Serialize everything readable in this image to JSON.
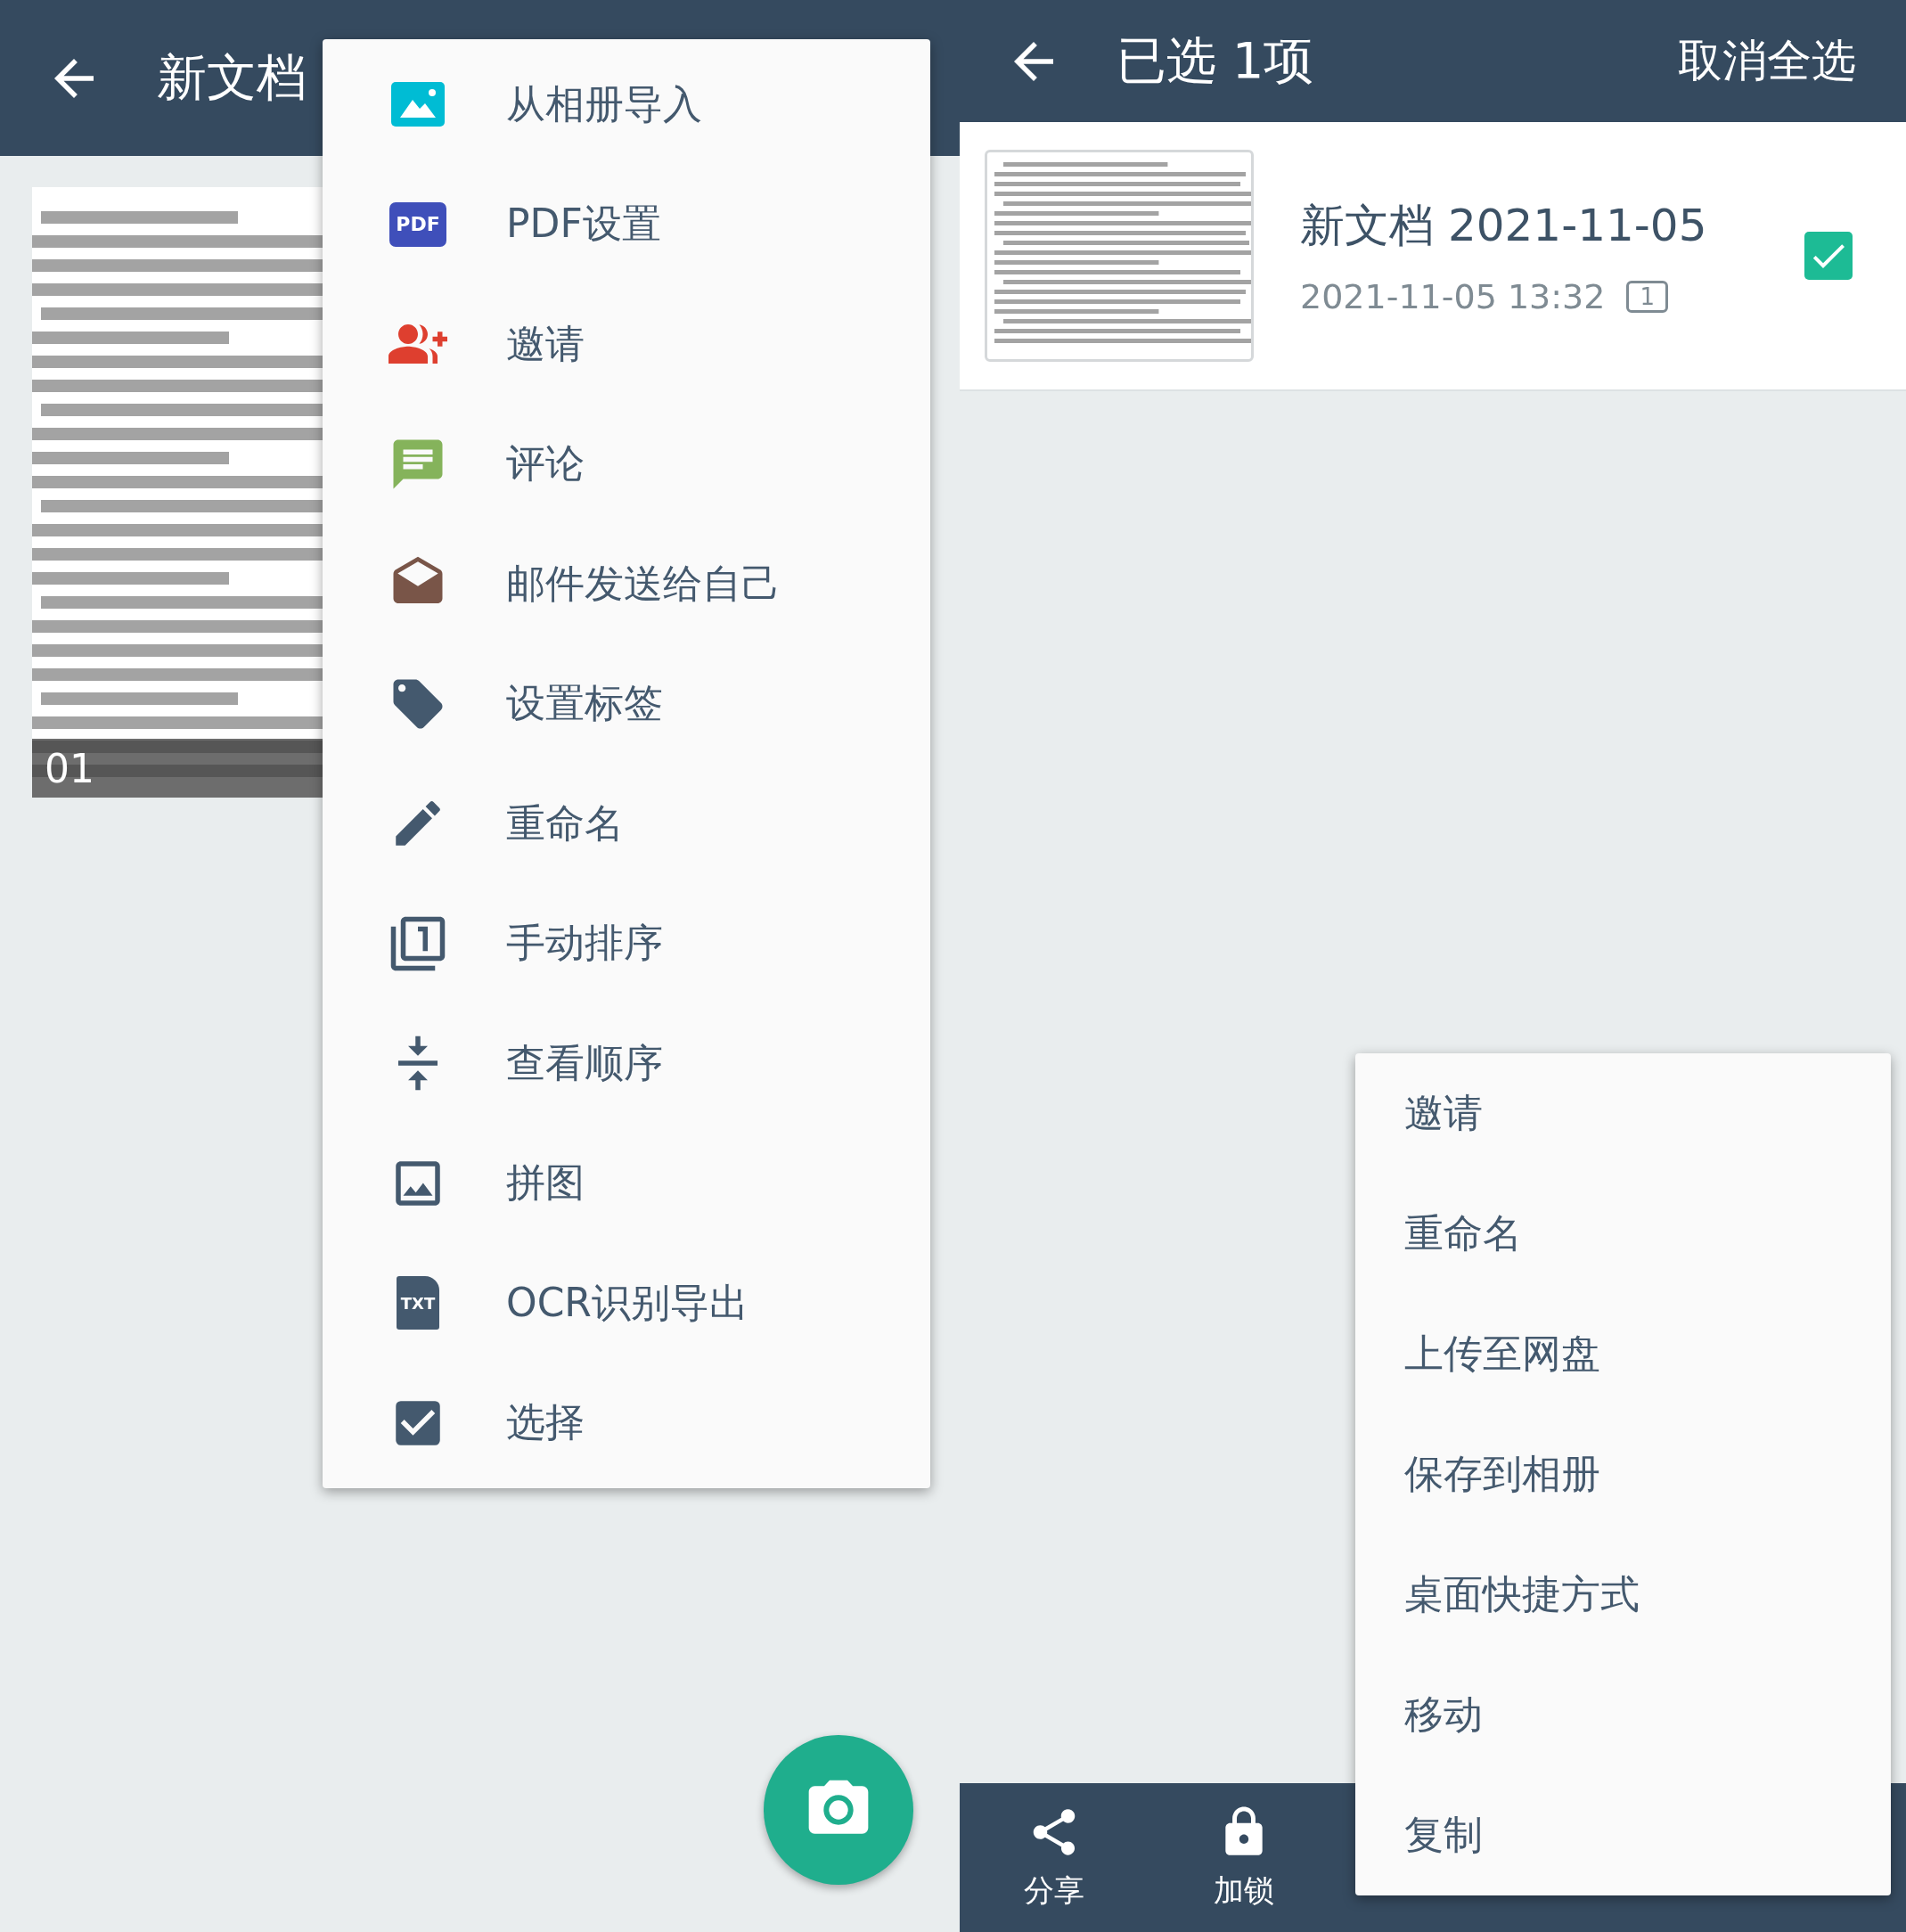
{
  "left_screen": {
    "app_bar": {
      "title": "新文档"
    },
    "page": {
      "page_number": "01"
    },
    "menu": {
      "items": [
        {
          "kind": "image",
          "label": "从相册导入"
        },
        {
          "kind": "pdf",
          "badge": "PDF",
          "label": "PDF设置"
        },
        {
          "kind": "invite",
          "label": "邀请"
        },
        {
          "kind": "comment",
          "label": "评论"
        },
        {
          "kind": "mail",
          "label": "邮件发送给自己"
        },
        {
          "kind": "tag",
          "label": "设置标签"
        },
        {
          "kind": "edit",
          "label": "重命名"
        },
        {
          "kind": "order",
          "label": "手动排序"
        },
        {
          "kind": "merge",
          "label": "查看顺序"
        },
        {
          "kind": "collage",
          "label": "拼图"
        },
        {
          "kind": "txt",
          "badge": "TXT",
          "label": "OCR识别导出"
        },
        {
          "kind": "select",
          "label": "选择"
        }
      ]
    }
  },
  "right_screen": {
    "app_bar": {
      "title": "已选 1项",
      "action": "取消全选"
    },
    "document": {
      "title": "新文档 2021-11-05",
      "date": "2021-11-05 13:32",
      "page_count": "1",
      "selected": true
    },
    "bottom_bar": [
      {
        "kind": "share",
        "label": "分享"
      },
      {
        "kind": "lock",
        "label": "加锁"
      }
    ],
    "menu": {
      "items": [
        "邀请",
        "重命名",
        "上传至网盘",
        "保存到相册",
        "桌面快捷方式",
        "移动",
        "复制"
      ]
    }
  }
}
